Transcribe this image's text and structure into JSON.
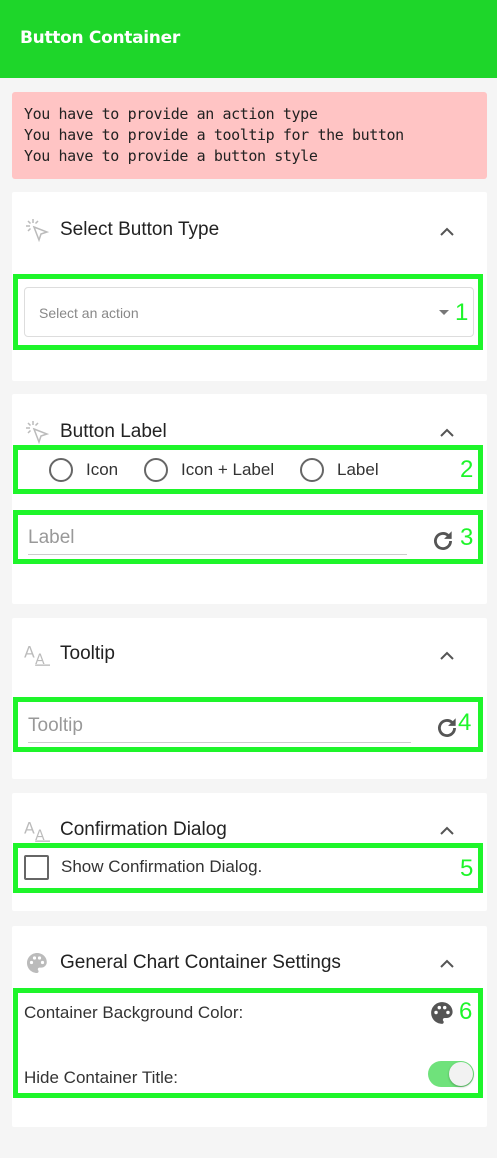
{
  "header": {
    "title": "Button Container"
  },
  "errors": [
    "You have to provide an action type",
    "You have to provide a tooltip for the button",
    "You have to provide a button style"
  ],
  "sections": {
    "button_type": {
      "title": "Select Button Type",
      "icon": "cursor-click-icon",
      "select_placeholder": "Select an action"
    },
    "button_label": {
      "title": "Button Label",
      "icon": "cursor-click-icon",
      "radios": [
        "Icon",
        "Icon + Label",
        "Label"
      ],
      "label_placeholder": "Label"
    },
    "tooltip": {
      "title": "Tooltip",
      "icon": "font-size-icon",
      "tooltip_placeholder": "Tooltip"
    },
    "confirmation": {
      "title": "Confirmation Dialog",
      "icon": "font-size-icon",
      "checkbox_label": "Show Confirmation Dialog."
    },
    "general": {
      "title": "General Chart Container Settings",
      "icon": "palette-icon",
      "bg_color_label": "Container Background Color:",
      "hide_title_label": "Hide Container Title:",
      "hide_title_on": true
    }
  },
  "annotations": [
    "1",
    "2",
    "3",
    "4",
    "5",
    "6"
  ],
  "colors": {
    "header": "#1ed62a",
    "error_bg": "#ffc4c4",
    "annotation": "#1ef52a",
    "toggle_on": "#6fe27b"
  }
}
